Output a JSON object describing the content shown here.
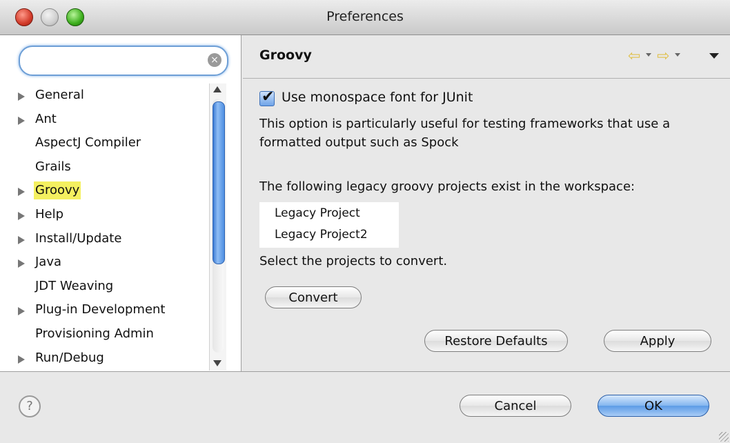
{
  "window": {
    "title": "Preferences"
  },
  "search": {
    "value": "",
    "placeholder": ""
  },
  "tree": {
    "items": [
      {
        "label": "General",
        "expandable": true
      },
      {
        "label": "Ant",
        "expandable": true
      },
      {
        "label": "AspectJ Compiler",
        "expandable": false
      },
      {
        "label": "Grails",
        "expandable": false
      },
      {
        "label": "Groovy",
        "expandable": true,
        "selected": true
      },
      {
        "label": "Help",
        "expandable": true
      },
      {
        "label": "Install/Update",
        "expandable": true
      },
      {
        "label": "Java",
        "expandable": true
      },
      {
        "label": "JDT Weaving",
        "expandable": false
      },
      {
        "label": "Plug-in Development",
        "expandable": true
      },
      {
        "label": "Provisioning Admin",
        "expandable": false
      },
      {
        "label": "Run/Debug",
        "expandable": true
      }
    ]
  },
  "page": {
    "title": "Groovy",
    "monospace_checkbox": {
      "label": "Use monospace font for JUnit",
      "checked": true
    },
    "description": "This option is particularly useful for testing frameworks that use a formatted output such as Spock",
    "legacy_heading": "The following legacy groovy projects exist in the workspace:",
    "legacy_projects": [
      "Legacy Project",
      "Legacy Project2"
    ],
    "select_hint": "Select the projects to convert.",
    "convert_label": "Convert",
    "restore_defaults_label": "Restore Defaults",
    "apply_label": "Apply"
  },
  "footer": {
    "help_icon_glyph": "?",
    "cancel_label": "Cancel",
    "ok_label": "OK"
  },
  "colors": {
    "selection_highlight": "#f4f060",
    "focus_ring": "#6e9fd6",
    "primary_button": "#5c9be6"
  }
}
